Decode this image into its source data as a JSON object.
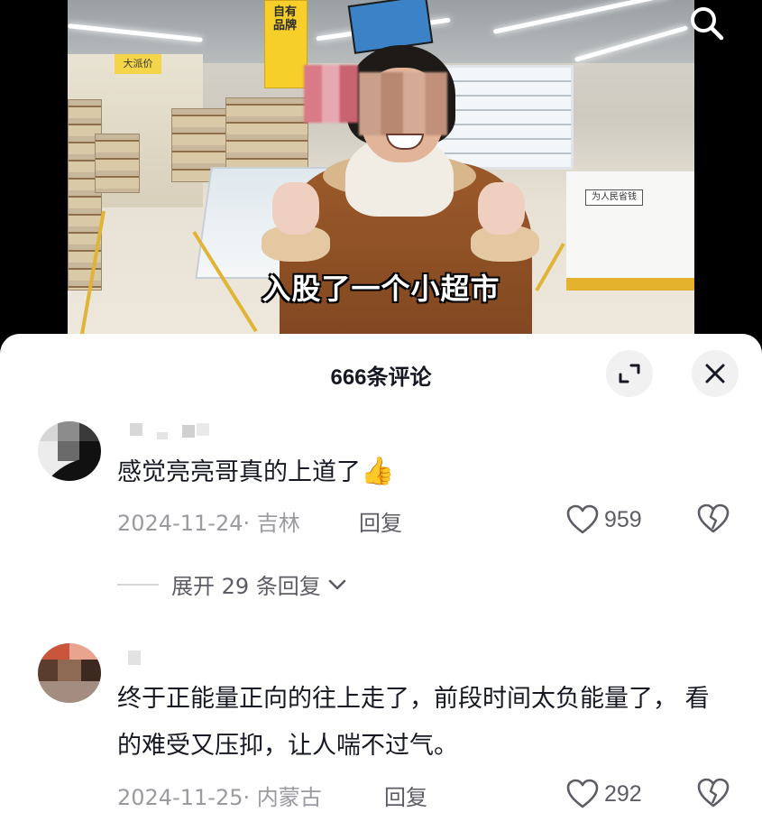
{
  "video": {
    "caption": "入股了一个小超市",
    "banner_text": "自有品牌",
    "left_sign": "大派价",
    "counter_sign": "为人民省钱"
  },
  "sheet": {
    "title": "666条评论",
    "expand_button_icon": "expand-corners-icon",
    "close_button_icon": "close-icon"
  },
  "comments": [
    {
      "text": "感觉亮亮哥真的上道了",
      "emoji": "👍",
      "date_location": "2024-11-24· 吉林",
      "reply_label": "回复",
      "likes": "959",
      "expand_replies": "展开 29 条回复"
    },
    {
      "text": "终于正能量正向的往上走了，前段时间太负能量了， 看的难受又压抑，让人喘不过气。",
      "date_location": "2024-11-25· 内蒙古",
      "reply_label": "回复",
      "likes": "292"
    }
  ],
  "colors": {
    "text_primary": "#161823",
    "text_secondary": "#9a9aa0",
    "button_bg": "#f1f1f2",
    "sheet_bg": "#ffffff",
    "video_bg": "#000000"
  }
}
